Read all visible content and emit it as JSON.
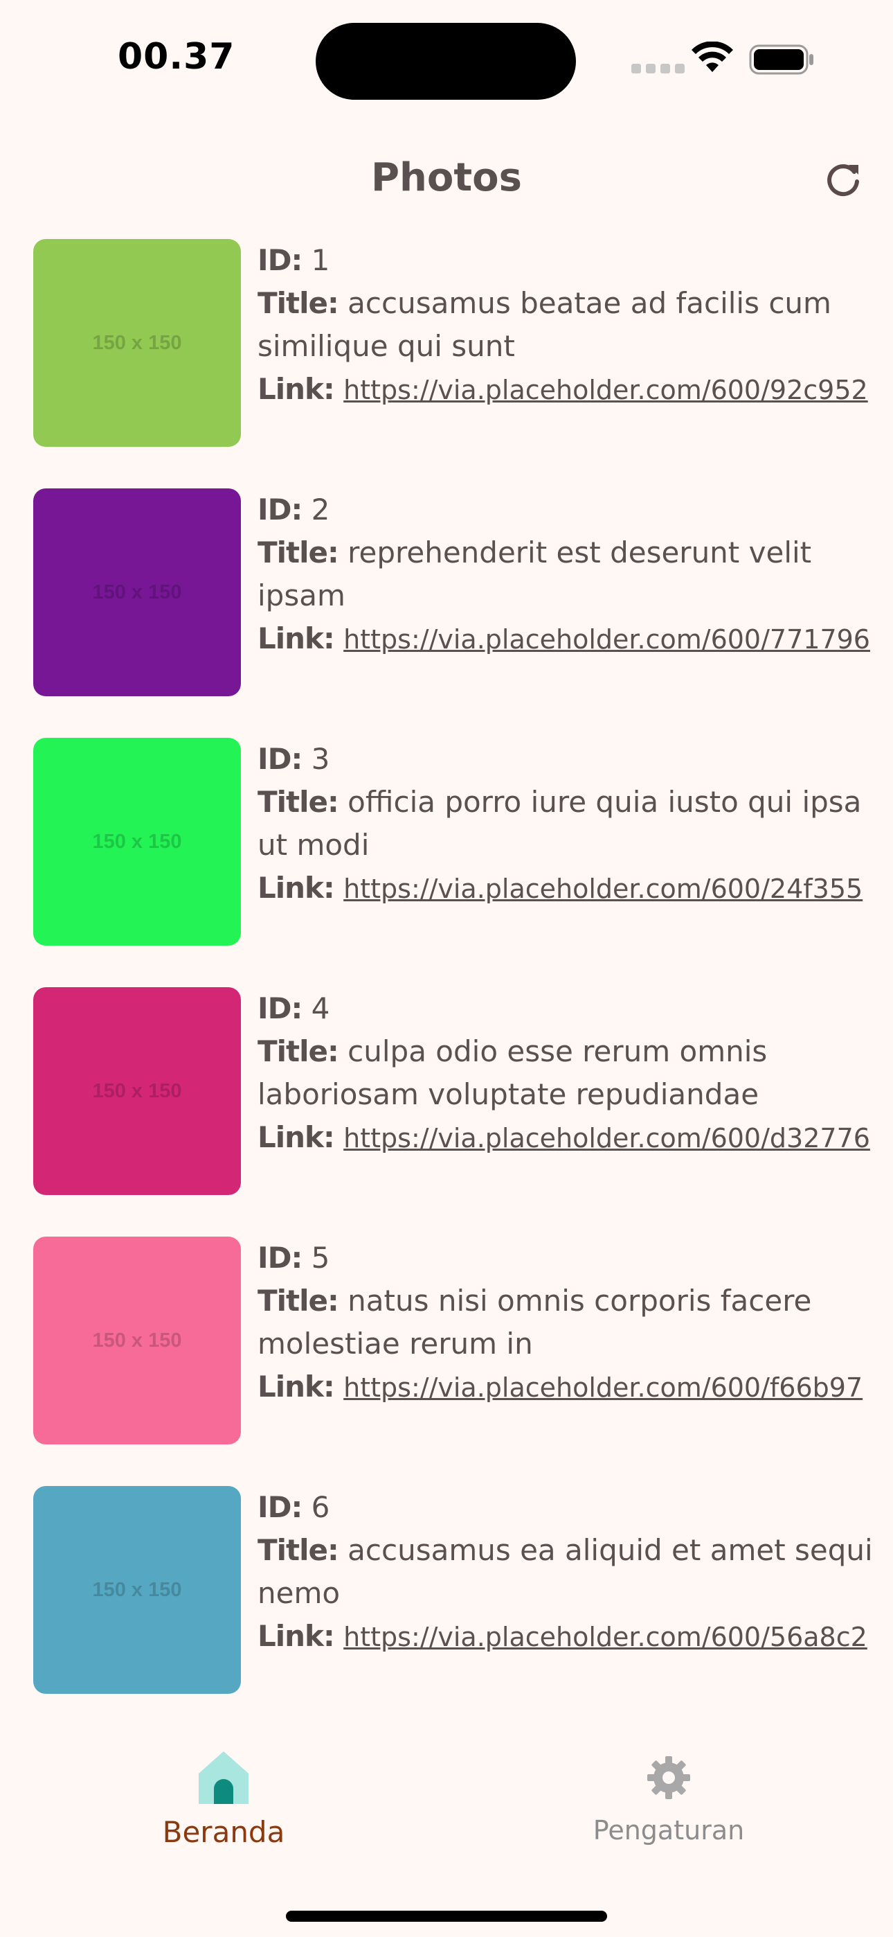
{
  "status_bar": {
    "time": "00.37"
  },
  "app_bar": {
    "title": "Photos",
    "refresh_icon": "refresh-icon"
  },
  "photos": [
    {
      "id_label": "ID:",
      "id": "1",
      "title_label": "Title:",
      "title": "accusamus beatae ad facilis cum similique qui sunt",
      "link_label": "Link:",
      "link": "https://via.placeholder.com/600/92c952",
      "thumb_text": "150 x 150",
      "color": "#92c952"
    },
    {
      "id_label": "ID:",
      "id": "2",
      "title_label": "Title:",
      "title": "reprehenderit est deserunt velit ipsam",
      "link_label": "Link:",
      "link": "https://via.placeholder.com/600/771796",
      "thumb_text": "150 x 150",
      "color": "#771796"
    },
    {
      "id_label": "ID:",
      "id": "3",
      "title_label": "Title:",
      "title": "officia porro iure quia iusto qui ipsa ut modi",
      "link_label": "Link:",
      "link": "https://via.placeholder.com/600/24f355",
      "thumb_text": "150 x 150",
      "color": "#24f355"
    },
    {
      "id_label": "ID:",
      "id": "4",
      "title_label": "Title:",
      "title": "culpa odio esse rerum omnis laboriosam voluptate repudiandae",
      "link_label": "Link:",
      "link": "https://via.placeholder.com/600/d32776",
      "thumb_text": "150 x 150",
      "color": "#d32776"
    },
    {
      "id_label": "ID:",
      "id": "5",
      "title_label": "Title:",
      "title": "natus nisi omnis corporis facere molestiae rerum in",
      "link_label": "Link:",
      "link": "https://via.placeholder.com/600/f66b97",
      "thumb_text": "150 x 150",
      "color": "#f66b97"
    },
    {
      "id_label": "ID:",
      "id": "6",
      "title_label": "Title:",
      "title": "accusamus ea aliquid et amet sequi nemo",
      "link_label": "Link:",
      "link": "https://via.placeholder.com/600/56a8c2",
      "thumb_text": "150 x 150",
      "color": "#56a8c2"
    }
  ],
  "bottom_nav": {
    "home": {
      "label": "Beranda",
      "icon": "home-icon",
      "active": true
    },
    "settings": {
      "label": "Pengaturan",
      "icon": "gear-icon",
      "active": false
    }
  },
  "colors": {
    "background": "#fff8f5",
    "text": "#5a5050",
    "active_nav_label": "#8a3a10",
    "active_nav_icon": "#0f8a7e",
    "active_nav_indicator": "#a8e6df",
    "inactive_nav": "#8c8c8c"
  }
}
